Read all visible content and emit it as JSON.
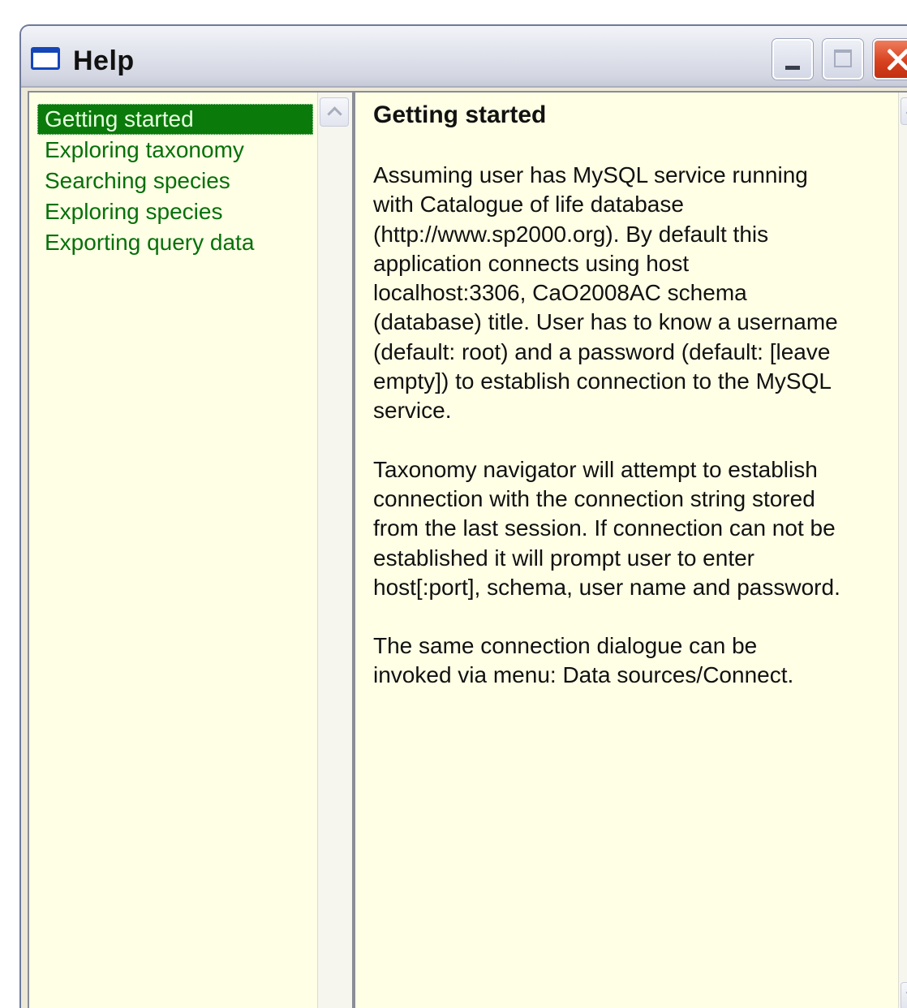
{
  "window": {
    "title": "Help",
    "icon": "window-icon",
    "controls": [
      "minimize-icon",
      "maximize-icon",
      "close-icon"
    ]
  },
  "topics": {
    "selected": "Getting started",
    "items": [
      {
        "label": "Getting started"
      },
      {
        "label": "Exploring taxonomy"
      },
      {
        "label": "Searching species"
      },
      {
        "label": "Exploring species"
      },
      {
        "label": "Exporting query data"
      }
    ]
  },
  "content": {
    "title": "Getting started",
    "paragraphs": [
      "Assuming user has MySQL service running\nwith Catalogue of life database\n(http://www.sp2000.org). By default this\napplication connects using host\nlocalhost:3306,  CaO2008AC schema\n(database) title. User has to know a username\n(default: root) and a password (default: [leave\nempty]) to establish connection to the MySQL\nservice.",
      "Taxonomy navigator will attempt to establish\nconnection with the connection string stored\nfrom the last session. If connection can not be\nestablished it will prompt user to enter\nhost[:port], schema, user name and password.",
      "The same connection dialogue can be\ninvoked via menu: Data sources/Connect."
    ]
  },
  "colors": {
    "pane_background": "#ffffe6",
    "topic_text": "#06700a",
    "topic_selected_background": "#0a7a0a",
    "close_button": "#d8421f"
  }
}
